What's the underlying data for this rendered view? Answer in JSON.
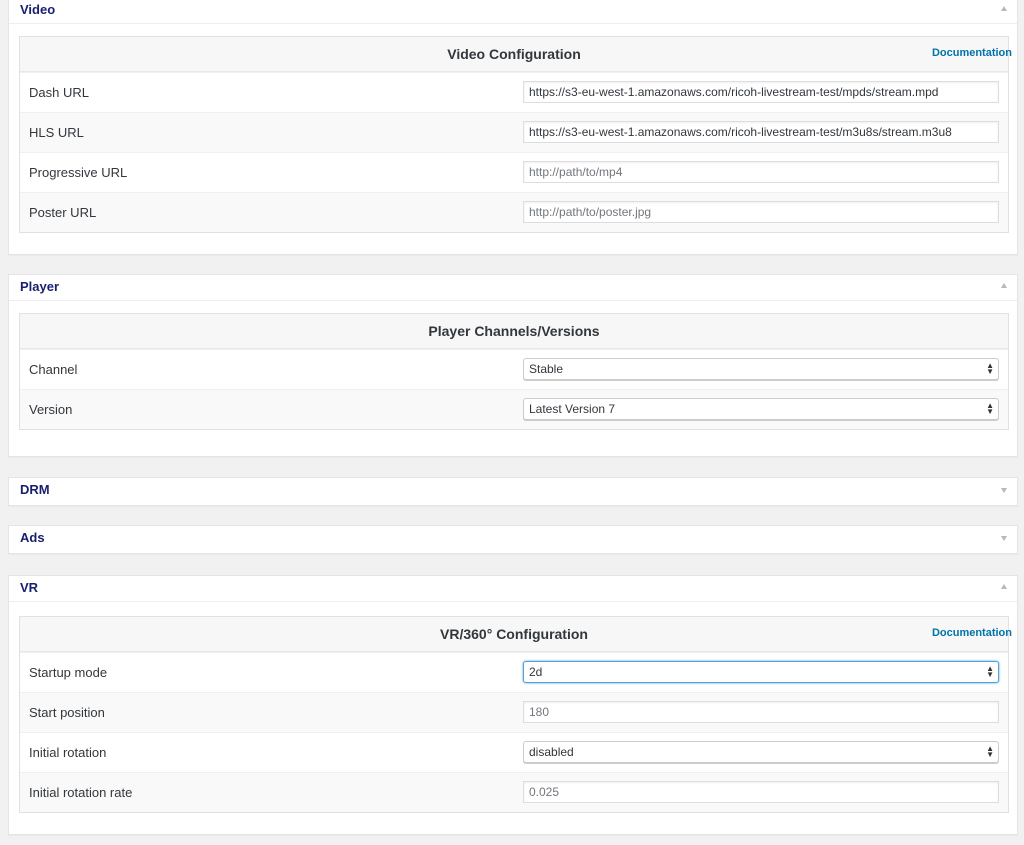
{
  "video": {
    "title": "Video",
    "panel_title": "Video Configuration",
    "doc_link": "Documentation",
    "rows": [
      {
        "label": "Dash URL",
        "value": "https://s3-eu-west-1.amazonaws.com/ricoh-livestream-test/mpds/stream.mpd"
      },
      {
        "label": "HLS URL",
        "value": "https://s3-eu-west-1.amazonaws.com/ricoh-livestream-test/m3u8s/stream.m3u8"
      },
      {
        "label": "Progressive URL",
        "placeholder": "http://path/to/mp4"
      },
      {
        "label": "Poster URL",
        "placeholder": "http://path/to/poster.jpg"
      }
    ]
  },
  "player": {
    "title": "Player",
    "panel_title": "Player Channels/Versions",
    "rows": [
      {
        "label": "Channel",
        "value": "Stable"
      },
      {
        "label": "Version",
        "value": "Latest Version 7"
      }
    ]
  },
  "drm": {
    "title": "DRM"
  },
  "ads": {
    "title": "Ads"
  },
  "vr": {
    "title": "VR",
    "panel_title": "VR/360° Configuration",
    "doc_link": "Documentation",
    "rows": [
      {
        "label": "Startup mode",
        "value": "2d"
      },
      {
        "label": "Start position",
        "placeholder": "180"
      },
      {
        "label": "Initial rotation",
        "value": "disabled"
      },
      {
        "label": "Initial rotation rate",
        "placeholder": "0.025"
      }
    ]
  }
}
